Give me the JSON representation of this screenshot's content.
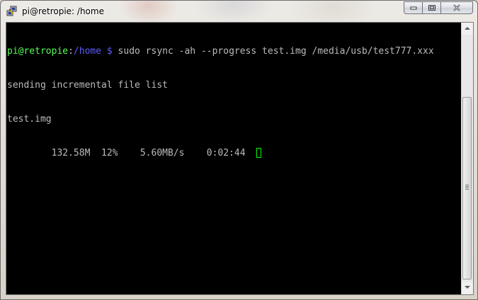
{
  "window": {
    "title": "pi@retropie: /home"
  },
  "terminal": {
    "prompt_user": "pi@retropie",
    "prompt_sep": ":",
    "prompt_path": "/home $",
    "command": " sudo rsync -ah --progress test.img /media/usb/test777.xxx",
    "line2": "sending incremental file list",
    "line3": "test.img",
    "progress_line": "        132.58M  12%    5.60MB/s    0:02:44  ",
    "progress": {
      "transferred": "132.58M",
      "percent": "12%",
      "rate": "5.60MB/s",
      "eta": "0:02:44"
    }
  },
  "colors": {
    "user": "#55ff55",
    "path": "#5c5cff",
    "text": "#bbbbbb",
    "background": "#000000",
    "cursor": "#00ff00"
  },
  "icons": {
    "app": "putty-icon",
    "minimize": "minimize-icon",
    "maximize": "maximize-icon",
    "close": "close-icon",
    "scroll_up": "arrow-up-icon",
    "scroll_down": "arrow-down-icon"
  }
}
